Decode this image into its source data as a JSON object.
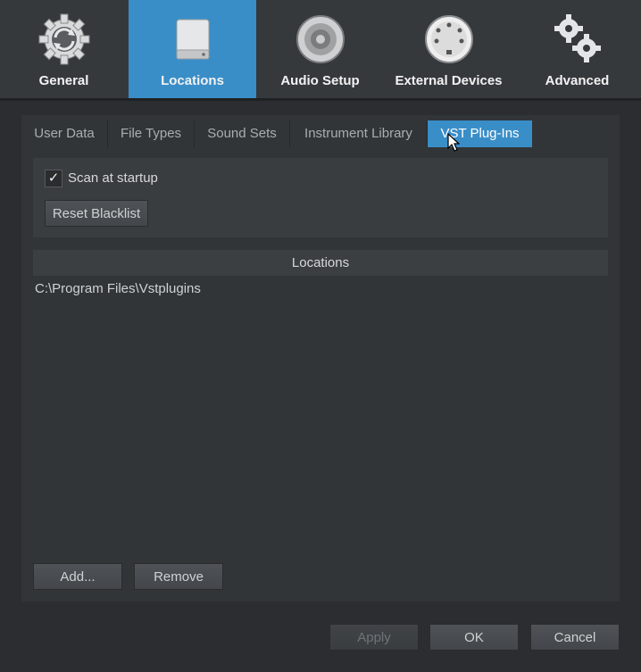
{
  "toolbar": {
    "items": [
      {
        "label": "General",
        "icon": "general-gear-refresh-icon"
      },
      {
        "label": "Locations",
        "icon": "drive-icon"
      },
      {
        "label": "Audio Setup",
        "icon": "speaker-icon"
      },
      {
        "label": "External Devices",
        "icon": "midi-port-icon"
      },
      {
        "label": "Advanced",
        "icon": "gears-icon"
      }
    ],
    "active_index": 1
  },
  "tabs": [
    {
      "label": "User Data"
    },
    {
      "label": "File Types"
    },
    {
      "label": "Sound Sets"
    },
    {
      "label": "Instrument Library"
    },
    {
      "label": "VST Plug-Ins"
    }
  ],
  "active_tab": "VST Plug-Ins",
  "options": {
    "scan_label": "Scan at startup",
    "scan_checked": true,
    "checkmark": "✓",
    "reset_label": "Reset Blacklist"
  },
  "locations": {
    "header": "Locations",
    "items": [
      "C:\\Program Files\\Vstplugins"
    ],
    "add_label": "Add...",
    "remove_label": "Remove"
  },
  "footer": {
    "apply_label": "Apply",
    "ok_label": "OK",
    "cancel_label": "Cancel"
  },
  "colors": {
    "accent": "#3a8ec8",
    "background": "#2b2d30"
  }
}
